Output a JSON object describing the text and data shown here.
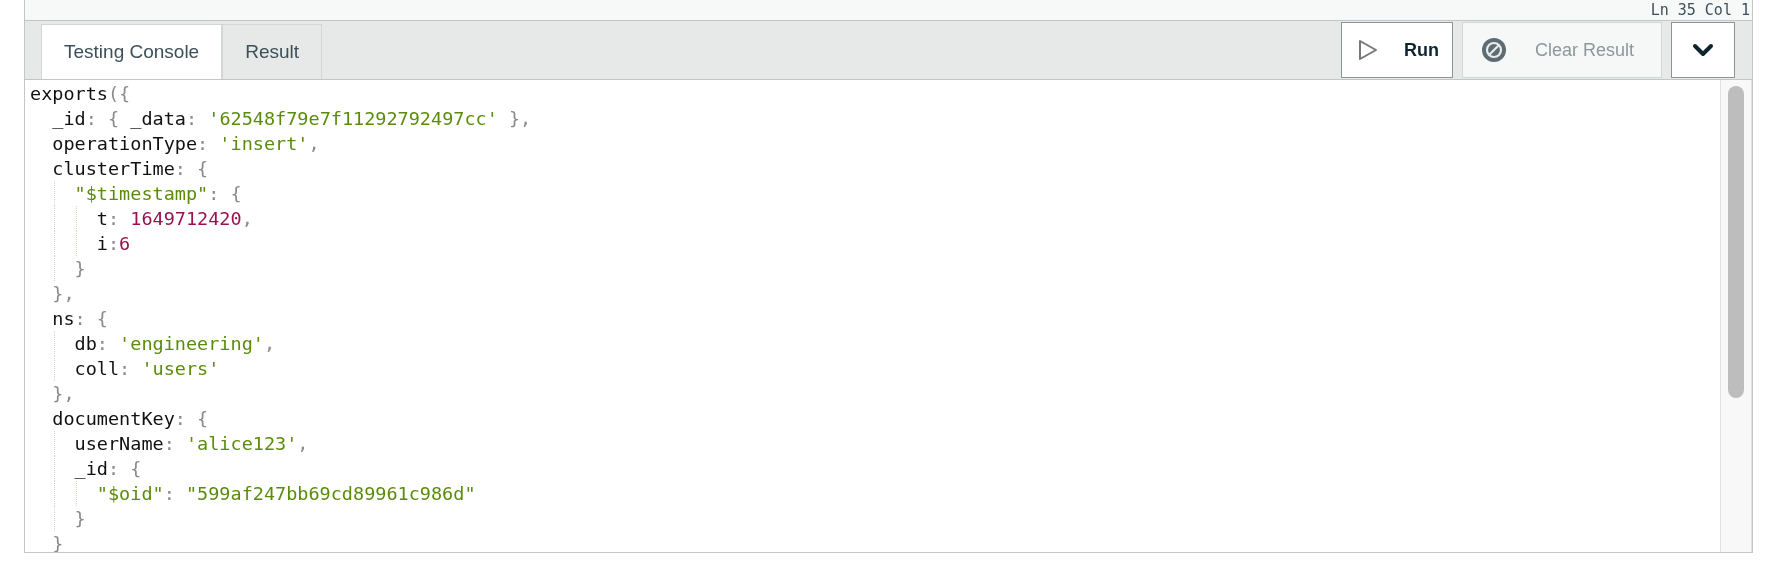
{
  "status": {
    "cursor": "Ln 35 Col 1"
  },
  "tabs": [
    {
      "label": "Testing Console",
      "selected": true
    },
    {
      "label": "Result",
      "selected": false
    }
  ],
  "toolbar": {
    "run": {
      "label": "Run",
      "disabled": false
    },
    "clear": {
      "label": "Clear Result",
      "disabled": true
    }
  },
  "code": {
    "lines": [
      {
        "tokens": [
          {
            "kind": "key",
            "text": "exports"
          },
          {
            "kind": "punct",
            "text": "({"
          }
        ]
      },
      {
        "tokens": [
          {
            "kind": "key",
            "text": "  _id"
          },
          {
            "kind": "punct",
            "text": ": { "
          },
          {
            "kind": "key",
            "text": "_data"
          },
          {
            "kind": "punct",
            "text": ": "
          },
          {
            "kind": "string",
            "text": "'62548f79e7f11292792497cc'"
          },
          {
            "kind": "punct",
            "text": " },"
          }
        ]
      },
      {
        "tokens": [
          {
            "kind": "key",
            "text": "  operationType"
          },
          {
            "kind": "punct",
            "text": ": "
          },
          {
            "kind": "string",
            "text": "'insert'"
          },
          {
            "kind": "punct",
            "text": ","
          }
        ]
      },
      {
        "tokens": [
          {
            "kind": "key",
            "text": "  clusterTime"
          },
          {
            "kind": "punct",
            "text": ": {"
          }
        ]
      },
      {
        "tokens": [
          {
            "kind": "string",
            "text": "    \"$timestamp\""
          },
          {
            "kind": "punct",
            "text": ": {"
          }
        ]
      },
      {
        "tokens": [
          {
            "kind": "key",
            "text": "      t"
          },
          {
            "kind": "punct",
            "text": ": "
          },
          {
            "kind": "number",
            "text": "1649712420"
          },
          {
            "kind": "punct",
            "text": ","
          }
        ]
      },
      {
        "tokens": [
          {
            "kind": "key",
            "text": "      i"
          },
          {
            "kind": "punct",
            "text": ":"
          },
          {
            "kind": "number",
            "text": "6"
          }
        ]
      },
      {
        "tokens": [
          {
            "kind": "punct",
            "text": "    }"
          }
        ]
      },
      {
        "tokens": [
          {
            "kind": "punct",
            "text": "  },"
          }
        ]
      },
      {
        "tokens": [
          {
            "kind": "key",
            "text": "  ns"
          },
          {
            "kind": "punct",
            "text": ": {"
          }
        ]
      },
      {
        "tokens": [
          {
            "kind": "key",
            "text": "    db"
          },
          {
            "kind": "punct",
            "text": ": "
          },
          {
            "kind": "string",
            "text": "'engineering'"
          },
          {
            "kind": "punct",
            "text": ","
          }
        ]
      },
      {
        "tokens": [
          {
            "kind": "key",
            "text": "    coll"
          },
          {
            "kind": "punct",
            "text": ": "
          },
          {
            "kind": "string",
            "text": "'users'"
          }
        ]
      },
      {
        "tokens": [
          {
            "kind": "punct",
            "text": "  },"
          }
        ]
      },
      {
        "tokens": [
          {
            "kind": "key",
            "text": "  documentKey"
          },
          {
            "kind": "punct",
            "text": ": {"
          }
        ]
      },
      {
        "tokens": [
          {
            "kind": "key",
            "text": "    userName"
          },
          {
            "kind": "punct",
            "text": ": "
          },
          {
            "kind": "string",
            "text": "'alice123'"
          },
          {
            "kind": "punct",
            "text": ","
          }
        ]
      },
      {
        "tokens": [
          {
            "kind": "key",
            "text": "    _id"
          },
          {
            "kind": "punct",
            "text": ": {"
          }
        ]
      },
      {
        "tokens": [
          {
            "kind": "string",
            "text": "      \"$oid\""
          },
          {
            "kind": "punct",
            "text": ": "
          },
          {
            "kind": "string",
            "text": "\"599af247bb69cd89961c986d\""
          }
        ]
      },
      {
        "tokens": [
          {
            "kind": "punct",
            "text": "    }"
          }
        ]
      },
      {
        "tokens": [
          {
            "kind": "punct",
            "text": "  }"
          }
        ]
      }
    ]
  }
}
